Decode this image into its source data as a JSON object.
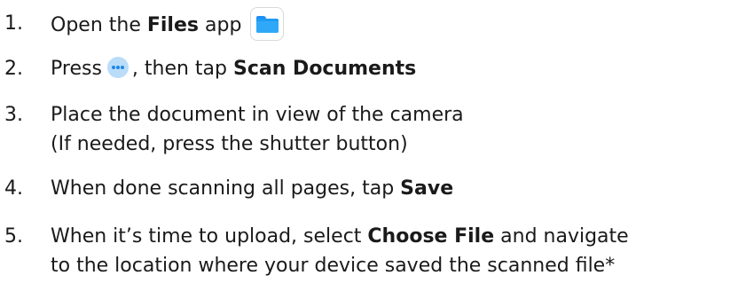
{
  "steps": [
    {
      "number": "1.",
      "parts": [
        "Open the ",
        "Files",
        " app"
      ]
    },
    {
      "number": "2.",
      "parts": [
        "Press",
        ", then tap ",
        "Scan Documents"
      ]
    },
    {
      "number": "3.",
      "line1": "Place the document in view of the camera",
      "line2": "(If needed, press the shutter button)"
    },
    {
      "number": "4.",
      "parts": [
        "When done scanning all pages, tap ",
        "Save"
      ]
    },
    {
      "number": "5.",
      "parts": [
        "When it’s time to upload, select ",
        "Choose File",
        " and navigate"
      ],
      "line2": "to the location where your device saved the scanned file*"
    }
  ],
  "icons": {
    "files_app": "files-app-icon",
    "more": "more-icon",
    "accent": "#1d9bf6"
  }
}
